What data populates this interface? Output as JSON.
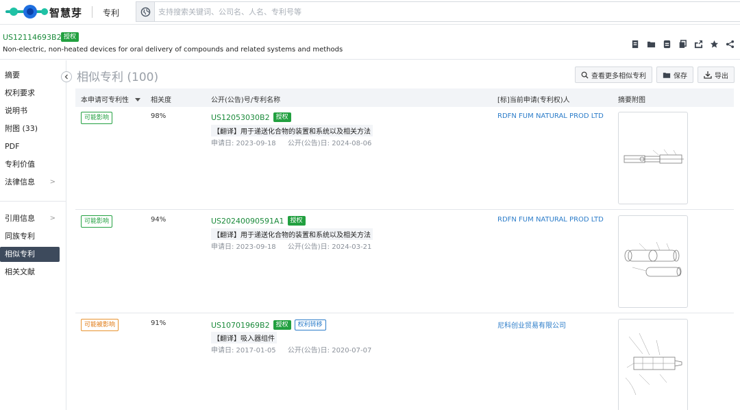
{
  "app": {
    "logo_text": "智慧芽",
    "module": "专利",
    "search_placeholder": "支持搜索关键词、公司名、人名、专利号等"
  },
  "patent": {
    "number": "US12114693B2",
    "status": "授权",
    "title": "Non-electric, non-heated devices for oral delivery of compounds and related systems and methods"
  },
  "sidebar": {
    "items": [
      {
        "label": "摘要"
      },
      {
        "label": "权利要求"
      },
      {
        "label": "说明书"
      },
      {
        "label": "附图 (33)"
      },
      {
        "label": "PDF"
      },
      {
        "label": "专利价值"
      },
      {
        "label": "法律信息"
      },
      {
        "label": "引用信息"
      },
      {
        "label": "同族专利"
      },
      {
        "label": "相似专利"
      },
      {
        "label": "相关文献"
      }
    ]
  },
  "main": {
    "section_title": "相似专利",
    "section_count": "(100)",
    "actions": {
      "more": "查看更多相似专利",
      "save": "保存",
      "export": "导出"
    },
    "columns": {
      "patentability": "本申请可专利性",
      "relevance": "相关度",
      "pubno": "公开(公告)号/专利名称",
      "owner": "[标]当前申请(专利权)人",
      "figure": "摘要附图"
    },
    "rows": [
      {
        "impact": "可能影响",
        "impact_color": "#22a040",
        "relevance": "98%",
        "pubno": "US12053030B2",
        "status": "授权",
        "transfer": "",
        "title": "【翻译】用于递送化合物的装置和系统以及相关方法",
        "app_date": "申请日: 2023-09-18",
        "pub_date": "公开(公告)日: 2024-08-06",
        "owner": "RDFN FUM NATURAL PROD LTD"
      },
      {
        "impact": "可能影响",
        "impact_color": "#22a040",
        "relevance": "94%",
        "pubno": "US20240090591A1",
        "status": "授权",
        "transfer": "",
        "title": "【翻译】用于递送化合物的装置和系统以及相关方法",
        "app_date": "申请日: 2023-09-18",
        "pub_date": "公开(公告)日: 2024-03-21",
        "owner": "RDFN FUM NATURAL PROD LTD"
      },
      {
        "impact": "可能被影响",
        "impact_color": "#e07b16",
        "relevance": "91%",
        "pubno": "US10701969B2",
        "status": "授权",
        "transfer": "权利转移",
        "title": "【翻译】吸入器组件",
        "app_date": "申请日: 2017-01-05",
        "pub_date": "公开(公告)日: 2020-07-07",
        "owner": "尼科创业贸易有限公司"
      }
    ]
  },
  "colors": {
    "brand_green": "#22a040",
    "link_blue": "#2b7cc9",
    "active_nav": "#3d4a5c"
  }
}
